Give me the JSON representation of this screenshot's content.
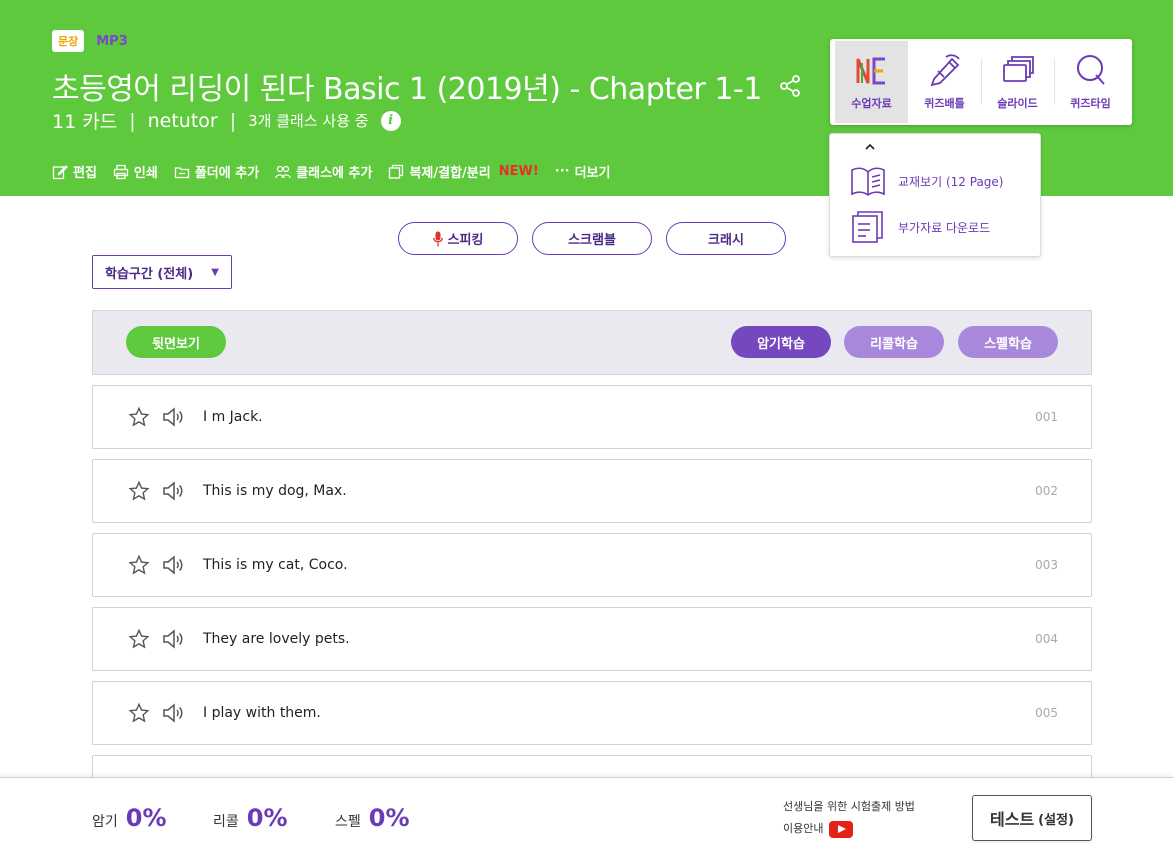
{
  "header": {
    "tag_sentence": "문장",
    "tag_mp3": "MP3",
    "title": "초등영어 리딩이 된다 Basic 1 (2019년) - Chapter 1-1",
    "card_count": "11 카드",
    "sep": "|",
    "author": "netutor",
    "usage": "3개 클래스 사용 중"
  },
  "actions": {
    "edit": "편집",
    "print": "인쇄",
    "add_folder": "폴더에 추가",
    "add_class": "클래스에 추가",
    "copy_merge": "복제/결합/분리",
    "new_badge": "NEW!",
    "more": "더보기"
  },
  "tools": {
    "materials": "수업자료",
    "quiz_battle": "퀴즈배틀",
    "slide": "슬라이드",
    "quiz_time": "퀴즈타임"
  },
  "dropdown": {
    "textbook": "교재보기 (12 Page)",
    "download": "부가자료 다운로드"
  },
  "modes": {
    "speaking": "스피킹",
    "scramble": "스크램블",
    "crash": "크래시"
  },
  "range_select": {
    "value": "학습구간 (전체)"
  },
  "study_bar": {
    "flip": "뒷면보기",
    "memorize": "암기학습",
    "recall": "리콜학습",
    "spell": "스펠학습"
  },
  "cards": [
    {
      "sentence": "I m Jack.",
      "num": "001"
    },
    {
      "sentence": "This is my dog, Max.",
      "num": "002"
    },
    {
      "sentence": "This is my cat, Coco.",
      "num": "003"
    },
    {
      "sentence": "They are lovely pets.",
      "num": "004"
    },
    {
      "sentence": "I play with them.",
      "num": "005"
    }
  ],
  "footer": {
    "memorize_label": "암기",
    "memorize_value": "0%",
    "recall_label": "리콜",
    "recall_value": "0%",
    "spell_label": "스펠",
    "spell_value": "0%",
    "guide_line1": "선생님을 위한 시험출제 방법",
    "guide_line2": "이용안내",
    "test_label": "테스트",
    "test_sub": "(설정)"
  },
  "colors": {
    "header_green": "#5ec93d",
    "purple": "#6b3bb6",
    "purple_light": "#a888dc",
    "new_red": "#e8302a"
  }
}
